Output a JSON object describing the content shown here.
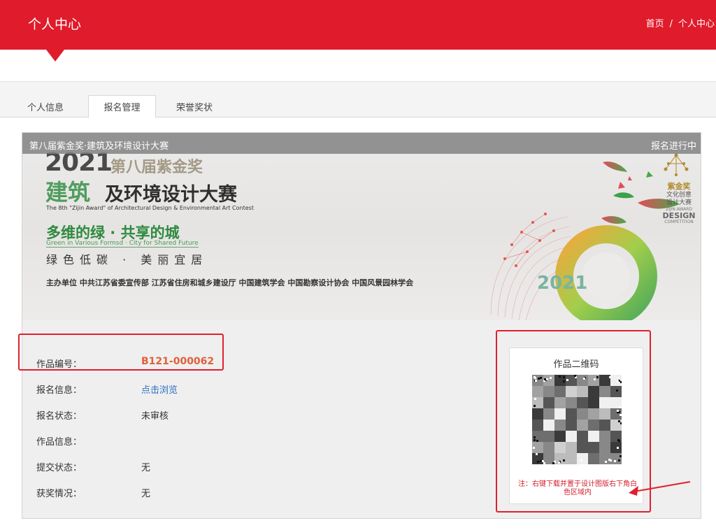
{
  "header": {
    "title": "个人中心",
    "breadcrumb": {
      "home": "首页",
      "separator": "/",
      "current": "个人中心"
    }
  },
  "tabs": [
    {
      "label": "个人信息",
      "active": false
    },
    {
      "label": "报名管理",
      "active": true
    },
    {
      "label": "荣誉奖状",
      "active": false
    }
  ],
  "card": {
    "title": "第八届紫金奖·建筑及环境设计大赛",
    "status": "报名进行中",
    "banner": {
      "year": "2021",
      "edition": "第八届紫金奖",
      "jian": "建筑",
      "contest": "及环境设计大赛",
      "english": "The 8th \"Zijin Award\" of Architectural Design & Environmental Art Contest",
      "theme": "多维的绿 · 共享的城",
      "theme_en": "Green in Various Formsd · City for Shared Future",
      "slogan": "绿色低碳 · 美丽宜居",
      "organizers": "主办单位  中共江苏省委宣传部  江苏省住房和城乡建设厅  中国建筑学会  中国勘察设计协会  中国风景园林学会",
      "logo_line1": "紫金奖",
      "logo_line2": "文化创意",
      "logo_line3": "设计大赛",
      "logo_line4": "ZIJIN AWARD",
      "logo_line5": "DESIGN",
      "logo_line6": "COMPETITION",
      "year_badge": "2021"
    },
    "fields": [
      {
        "label": "作品编号：",
        "value": "B121-000062"
      },
      {
        "label": "报名信息：",
        "value": "点击浏览"
      },
      {
        "label": "报名状态：",
        "value": "未审核"
      },
      {
        "label": "作品信息：",
        "value": ""
      },
      {
        "label": "提交状态：",
        "value": "无"
      },
      {
        "label": "获奖情况：",
        "value": "无"
      }
    ],
    "qr": {
      "title": "作品二维码",
      "note": "注：右键下载并置于设计图版右下角白色区域内"
    }
  },
  "colors": {
    "brand_red": "#e01b2b",
    "link_blue": "#2a6ec4",
    "code_orange": "#e0603a",
    "note_red": "#d4202d"
  }
}
